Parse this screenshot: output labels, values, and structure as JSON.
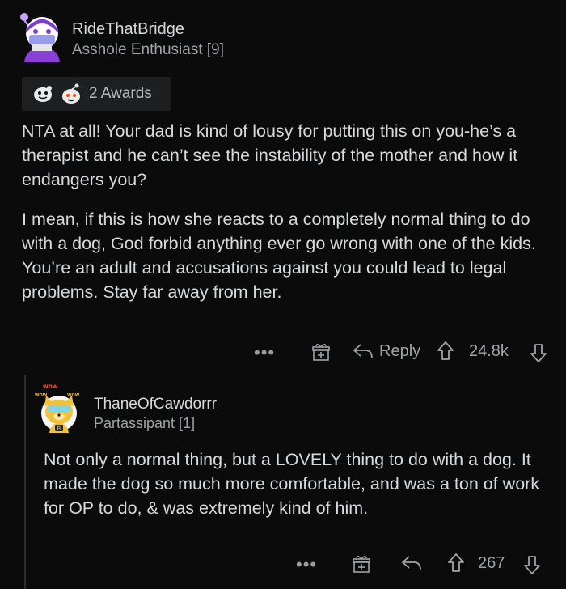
{
  "comment1": {
    "username": "RideThatBridge",
    "flair": "Asshole Enthusiast [9]",
    "awards_label": "2 Awards",
    "paragraphs": [
      "NTA at all! Your dad is kind of lousy for putting this on you-he’s a therapist and he can’t see the instability of the mother and how it endangers you?",
      "I mean, if this is how she reacts to a completely normal thing to do with a dog, God forbid anything ever go wrong with one of the kids. You’re an adult and accusations against you could lead to legal problems. Stay far away from her."
    ],
    "more_label": "•••",
    "reply_label": "Reply",
    "score": "24.8k"
  },
  "comment2": {
    "username": "ThaneOfCawdorrr",
    "flair": "Partassipant [1]",
    "avatar_badge": "WOW",
    "paragraphs": [
      "Not only a normal thing, but a LOVELY thing to do with a dog.  It made the dog so much more comfortable, and was a ton of work for OP to do, & was extremely kind of him."
    ],
    "more_label": "•••",
    "score": "267"
  },
  "colors": {
    "background": "#0b0b0b",
    "text": "#d7dadc",
    "muted": "#a0a4a8",
    "avatar_accent": "#c9a3ff",
    "award_bg": "#1e1f20"
  },
  "icons": [
    "avatar-purple-mask",
    "award-silver",
    "award-wholesome",
    "gift-icon",
    "reply-arrow-icon",
    "upvote-icon",
    "downvote-icon",
    "avatar-yellow-dog"
  ]
}
